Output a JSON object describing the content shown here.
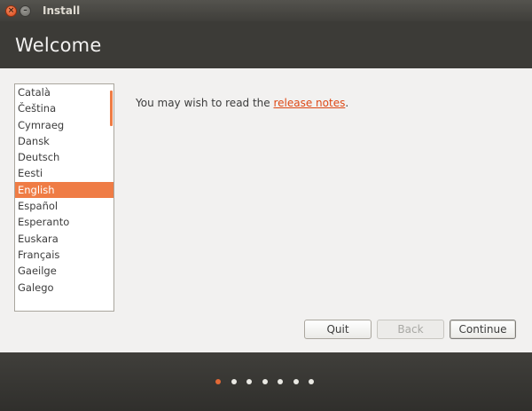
{
  "window": {
    "title": "Install",
    "close_symbol": "×",
    "minimize_symbol": "–"
  },
  "header": {
    "title": "Welcome"
  },
  "languages": {
    "items": [
      "Català",
      "Čeština",
      "Cymraeg",
      "Dansk",
      "Deutsch",
      "Eesti",
      "English",
      "Español",
      "Esperanto",
      "Euskara",
      "Français",
      "Gaeilge",
      "Galego"
    ],
    "selected": "English"
  },
  "notes": {
    "prefix": "You may wish to read the ",
    "link": "release notes",
    "suffix": "."
  },
  "buttons": {
    "quit": "Quit",
    "back": "Back",
    "continue": "Continue"
  },
  "progress": {
    "total_steps": 7,
    "current_step": 1
  },
  "colors": {
    "accent": "#ef7c45",
    "link": "#dd4814",
    "dark_bg": "#3c3b37",
    "content_bg": "#f2f1f0"
  }
}
